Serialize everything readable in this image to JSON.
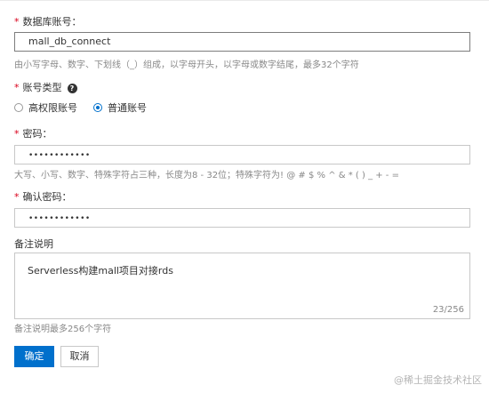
{
  "form": {
    "account": {
      "label": "数据库账号：",
      "value": "mall_db_connect",
      "help": "由小写字母、数字、下划线（_）组成，以字母开头，以字母或数字结尾，最多32个字符"
    },
    "account_type": {
      "label": "账号类型",
      "options": [
        "高权限账号",
        "普通账号"
      ],
      "selected": "普通账号"
    },
    "password": {
      "label": "密码：",
      "value": "••••••••••••",
      "help": "大写、小写、数字、特殊字符占三种，长度为8 - 32位；特殊字符为! @ # $ % ^ & * ( ) _ + - ="
    },
    "confirm_password": {
      "label": "确认密码：",
      "value": "••••••••••••"
    },
    "remark": {
      "label": "备注说明",
      "value": "Serverless构建mall项目对接rds",
      "count": "23/256",
      "help": "备注说明最多256个字符"
    },
    "required_mark": "*",
    "help_glyph": "?"
  },
  "buttons": {
    "confirm": "确定",
    "cancel": "取消"
  },
  "watermark": "@稀土掘金技术社区",
  "colors": {
    "accent": "#0070cc",
    "required": "#d9001b"
  }
}
